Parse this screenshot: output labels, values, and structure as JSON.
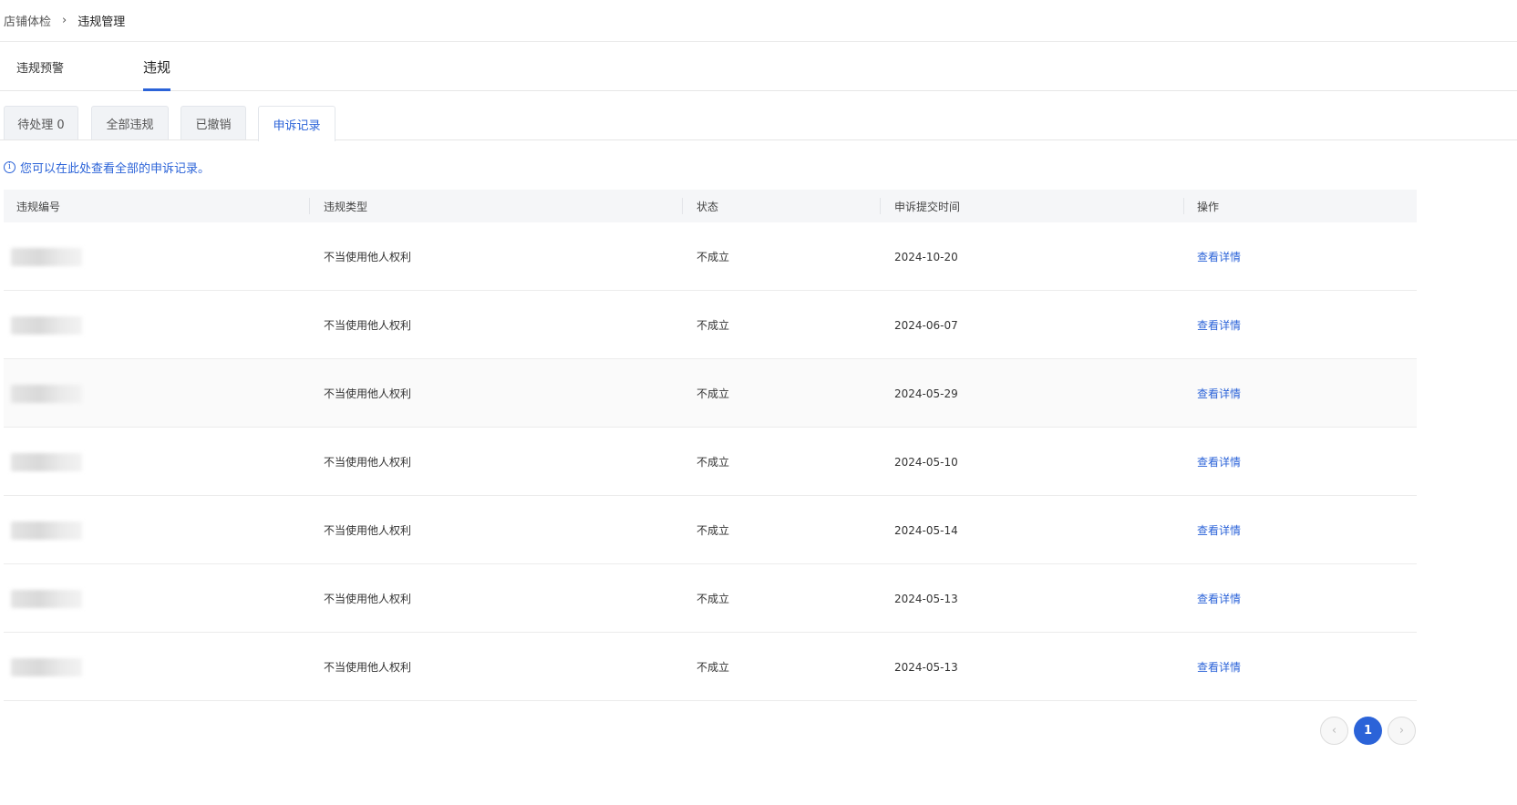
{
  "breadcrumb": {
    "parent": "店铺体检",
    "separator": "›",
    "current": "违规管理"
  },
  "primary_tabs": [
    {
      "label": "违规预警",
      "active": false
    },
    {
      "label": "违规",
      "active": true
    }
  ],
  "card_tabs": [
    {
      "label": "待处理 0",
      "active": false
    },
    {
      "label": "全部违规",
      "active": false
    },
    {
      "label": "已撤销",
      "active": false
    },
    {
      "label": "申诉记录",
      "active": true
    }
  ],
  "notice": {
    "icon": "info-icon",
    "text": "您可以在此处查看全部的申诉记录。"
  },
  "table": {
    "headers": [
      "违规编号",
      "违规类型",
      "状态",
      "申诉提交时间",
      "操作"
    ],
    "rows": [
      {
        "id": "",
        "type": "不当使用他人权利",
        "status": "不成立",
        "date": "2024-10-20",
        "action": "查看详情"
      },
      {
        "id": "",
        "type": "不当使用他人权利",
        "status": "不成立",
        "date": "2024-06-07",
        "action": "查看详情"
      },
      {
        "id": "",
        "type": "不当使用他人权利",
        "status": "不成立",
        "date": "2024-05-29",
        "action": "查看详情"
      },
      {
        "id": "",
        "type": "不当使用他人权利",
        "status": "不成立",
        "date": "2024-05-10",
        "action": "查看详情"
      },
      {
        "id": "",
        "type": "不当使用他人权利",
        "status": "不成立",
        "date": "2024-05-14",
        "action": "查看详情"
      },
      {
        "id": "",
        "type": "不当使用他人权利",
        "status": "不成立",
        "date": "2024-05-13",
        "action": "查看详情"
      },
      {
        "id": "",
        "type": "不当使用他人权利",
        "status": "不成立",
        "date": "2024-05-13",
        "action": "查看详情"
      }
    ]
  },
  "pagination": {
    "prev": "‹",
    "current_page": "1",
    "next": "›"
  },
  "colors": {
    "accent": "#2b63d8"
  }
}
